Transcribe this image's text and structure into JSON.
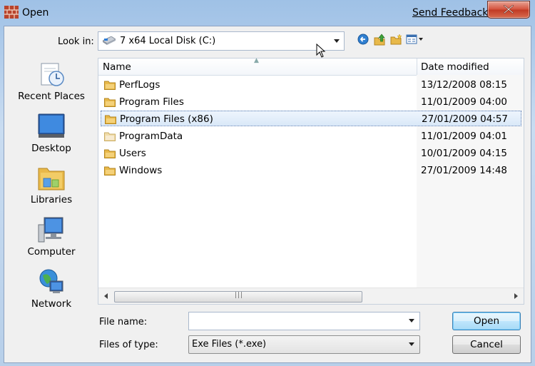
{
  "window": {
    "title": "Open",
    "feedback_link": "Send Feedback"
  },
  "toolbar": {
    "look_in_label": "Look in:",
    "look_in_value": "7 x64 Local Disk (C:)"
  },
  "places": [
    {
      "label": "Recent Places",
      "icon": "recent-places-icon"
    },
    {
      "label": "Desktop",
      "icon": "desktop-icon"
    },
    {
      "label": "Libraries",
      "icon": "libraries-icon"
    },
    {
      "label": "Computer",
      "icon": "computer-icon"
    },
    {
      "label": "Network",
      "icon": "network-icon"
    }
  ],
  "list": {
    "columns": [
      "Name",
      "Date modified"
    ],
    "rows": [
      {
        "name": "PerfLogs",
        "date": "13/12/2008 08:15"
      },
      {
        "name": "Program Files",
        "date": "11/01/2009 04:00"
      },
      {
        "name": "Program Files (x86)",
        "date": "27/01/2009 04:57",
        "selected": true
      },
      {
        "name": "ProgramData",
        "date": "11/01/2009 04:01"
      },
      {
        "name": "Users",
        "date": "10/01/2009 04:15"
      },
      {
        "name": "Windows",
        "date": "27/01/2009 14:48"
      }
    ]
  },
  "footer": {
    "file_name_label": "File name:",
    "file_name_value": "",
    "file_type_label": "Files of type:",
    "file_type_value": "Exe Files (*.exe)",
    "open_label": "Open",
    "cancel_label": "Cancel"
  },
  "colors": {
    "close": "#c13a24",
    "accent": "#3c7fb1",
    "folder": "#e8b94a"
  }
}
